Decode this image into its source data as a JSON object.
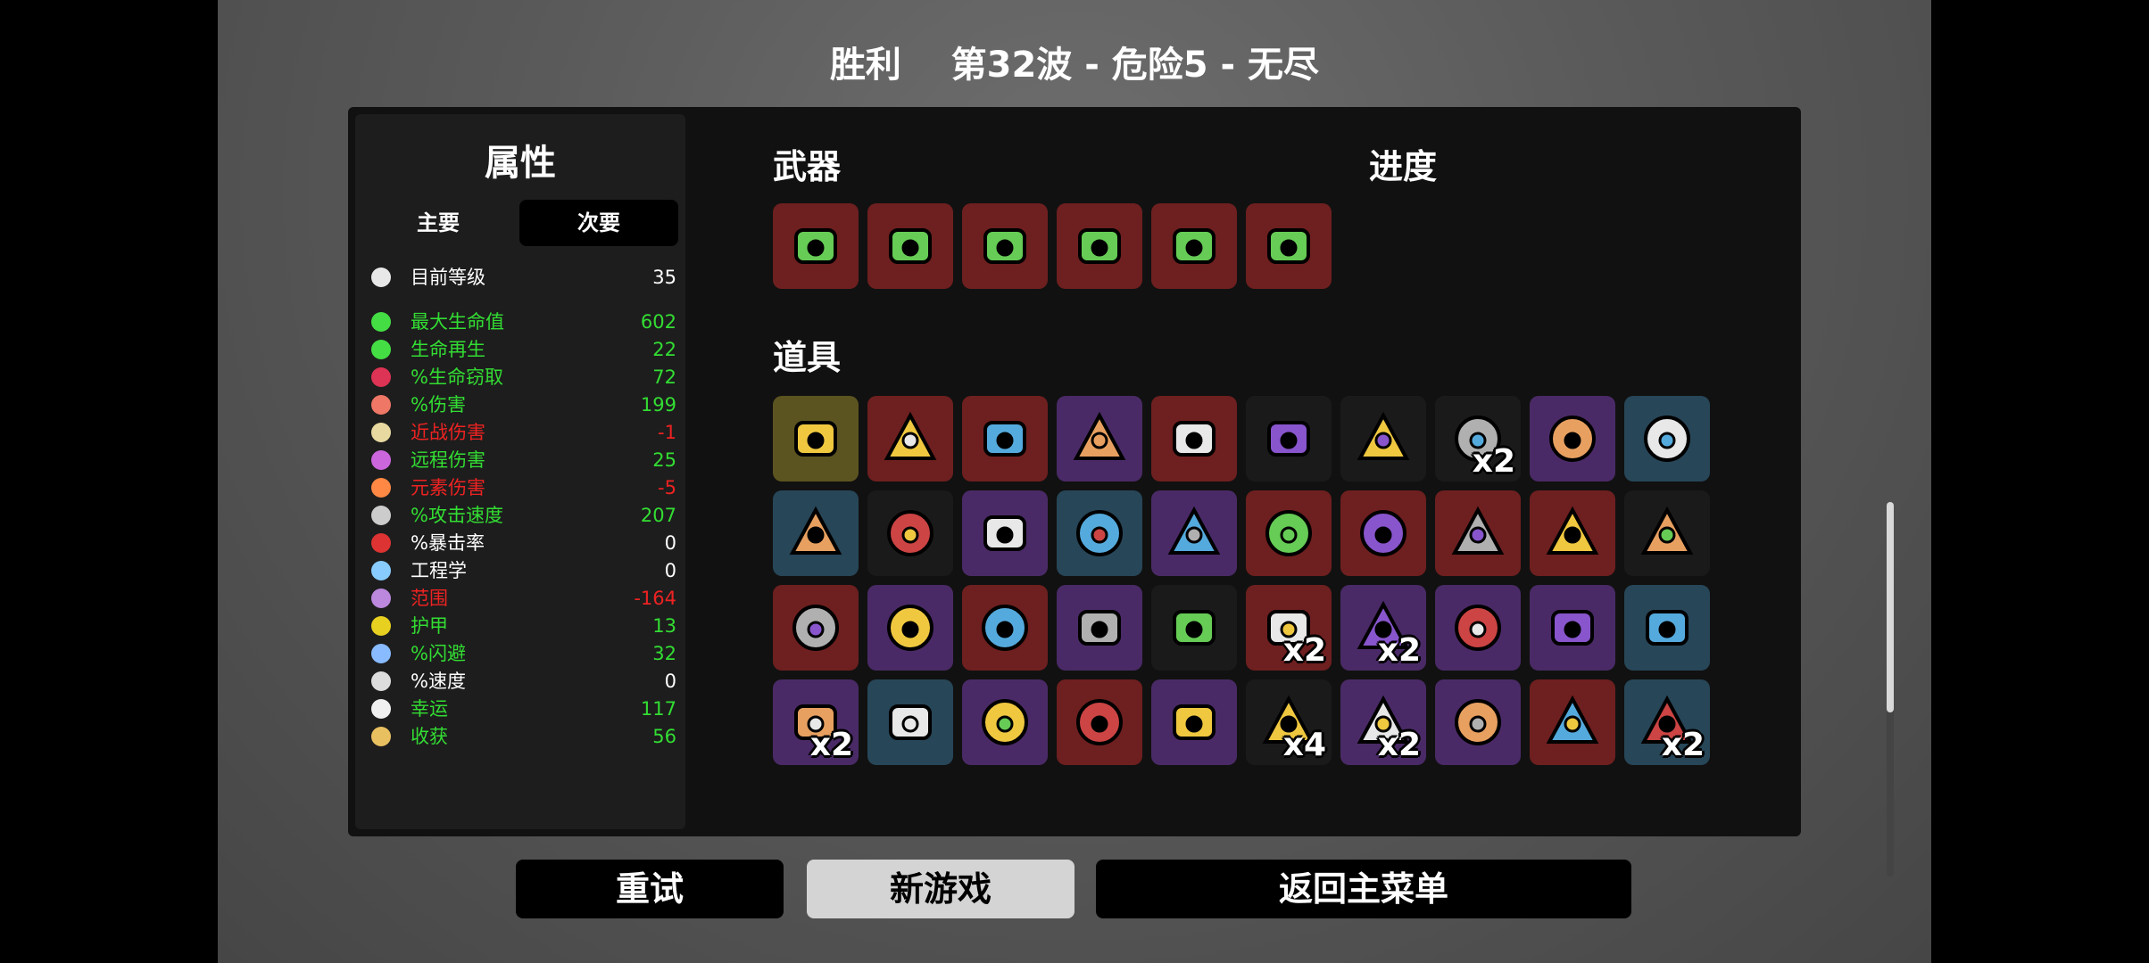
{
  "header": {
    "result": "胜利",
    "wave_info": "第32波 - 危险5 - 无尽"
  },
  "stats": {
    "title": "属性",
    "tabs": [
      "主要",
      "次要"
    ],
    "active_tab": "次要",
    "level": {
      "label": "目前等级",
      "value": "35",
      "icon": "level-icon"
    },
    "rows": [
      {
        "label": "最大生命值",
        "value": "602",
        "color": "#33dd33",
        "icon": "heart-icon"
      },
      {
        "label": "生命再生",
        "value": "22",
        "color": "#33dd33",
        "icon": "regen-heart-icon"
      },
      {
        "label": "%生命窃取",
        "value": "72",
        "color": "#33dd33",
        "icon": "fangs-icon"
      },
      {
        "label": "%伤害",
        "value": "199",
        "color": "#33dd33",
        "icon": "muscle-icon"
      },
      {
        "label": "近战伤害",
        "value": "-1",
        "color": "#ee2222",
        "icon": "sword-icon"
      },
      {
        "label": "远程伤害",
        "value": "25",
        "color": "#33dd33",
        "icon": "bow-icon"
      },
      {
        "label": "元素伤害",
        "value": "-5",
        "color": "#ee2222",
        "icon": "flame-icon"
      },
      {
        "label": "%攻击速度",
        "value": "207",
        "color": "#33dd33",
        "icon": "hourglass-icon"
      },
      {
        "label": "%暴击率",
        "value": "0",
        "color": "#ffffff",
        "icon": "crit-icon"
      },
      {
        "label": "工程学",
        "value": "0",
        "color": "#ffffff",
        "icon": "wrench-icon"
      },
      {
        "label": "范围",
        "value": "-164",
        "color": "#ee2222",
        "icon": "range-icon"
      },
      {
        "label": "护甲",
        "value": "13",
        "color": "#33dd33",
        "icon": "shield-icon"
      },
      {
        "label": "%闪避",
        "value": "32",
        "color": "#33dd33",
        "icon": "dodge-icon"
      },
      {
        "label": "%速度",
        "value": "0",
        "color": "#ffffff",
        "icon": "boot-icon"
      },
      {
        "label": "幸运",
        "value": "117",
        "color": "#33dd33",
        "icon": "dice-icon"
      },
      {
        "label": "收获",
        "value": "56",
        "color": "#33dd33",
        "icon": "harvest-icon"
      }
    ]
  },
  "weapons": {
    "title": "武器",
    "items": [
      {
        "icon": "minigun-icon",
        "tier_color": "#6e1f1f"
      },
      {
        "icon": "minigun-icon",
        "tier_color": "#6e1f1f"
      },
      {
        "icon": "minigun-icon",
        "tier_color": "#6e1f1f"
      },
      {
        "icon": "minigun-icon",
        "tier_color": "#6e1f1f"
      },
      {
        "icon": "minigun-icon",
        "tier_color": "#6e1f1f"
      },
      {
        "icon": "minigun-icon",
        "tier_color": "#6e1f1f"
      }
    ]
  },
  "progress": {
    "title": "进度"
  },
  "items": {
    "title": "道具",
    "list": [
      {
        "icon": "egg-face-icon",
        "tier_color": "#5c5420",
        "qty": ""
      },
      {
        "icon": "torn-hand-icon",
        "tier_color": "#6e1f1f",
        "qty": ""
      },
      {
        "icon": "bullet-icon",
        "tier_color": "#6e1f1f",
        "qty": ""
      },
      {
        "icon": "ring-icon",
        "tier_color": "#4a2a66",
        "qty": ""
      },
      {
        "icon": "jacket-icon",
        "tier_color": "#6e1f1f",
        "qty": ""
      },
      {
        "icon": "jar-icon",
        "tier_color": "#1a1a1a",
        "qty": ""
      },
      {
        "icon": "helmet-icon",
        "tier_color": "#1a1a1a",
        "qty": ""
      },
      {
        "icon": "claw-icon",
        "tier_color": "#1a1a1a",
        "qty": "x2"
      },
      {
        "icon": "wand-icon",
        "tier_color": "#4a2a66",
        "qty": ""
      },
      {
        "icon": "spike-icon",
        "tier_color": "#274658",
        "qty": ""
      },
      {
        "icon": "rifle-icon",
        "tier_color": "#274658",
        "qty": ""
      },
      {
        "icon": "map-icon",
        "tier_color": "#1a1a1a",
        "qty": ""
      },
      {
        "icon": "skulls-icon",
        "tier_color": "#4a2a66",
        "qty": ""
      },
      {
        "icon": "tentacle-icon",
        "tier_color": "#274658",
        "qty": ""
      },
      {
        "icon": "bucket-icon",
        "tier_color": "#4a2a66",
        "qty": ""
      },
      {
        "icon": "spear-icon",
        "tier_color": "#6e1f1f",
        "qty": ""
      },
      {
        "icon": "cape-icon",
        "tier_color": "#6e1f1f",
        "qty": ""
      },
      {
        "icon": "potato-icon",
        "tier_color": "#6e1f1f",
        "qty": ""
      },
      {
        "icon": "explosion-icon",
        "tier_color": "#6e1f1f",
        "qty": ""
      },
      {
        "icon": "cake-icon",
        "tier_color": "#1a1a1a",
        "qty": ""
      },
      {
        "icon": "stomach-icon",
        "tier_color": "#6e1f1f",
        "qty": ""
      },
      {
        "icon": "tardigrade-icon",
        "tier_color": "#4a2a66",
        "qty": ""
      },
      {
        "icon": "snowflake-icon",
        "tier_color": "#6e1f1f",
        "qty": ""
      },
      {
        "icon": "crown-icon",
        "tier_color": "#4a2a66",
        "qty": ""
      },
      {
        "icon": "bird-skull-icon",
        "tier_color": "#1a1a1a",
        "qty": ""
      },
      {
        "icon": "leaf-icon",
        "tier_color": "#6e1f1f",
        "qty": "x2"
      },
      {
        "icon": "flask-icon",
        "tier_color": "#4a2a66",
        "qty": "x2"
      },
      {
        "icon": "statue-icon",
        "tier_color": "#4a2a66",
        "qty": ""
      },
      {
        "icon": "demon-icon",
        "tier_color": "#4a2a66",
        "qty": ""
      },
      {
        "icon": "robot-icon",
        "tier_color": "#274658",
        "qty": ""
      },
      {
        "icon": "peacock-icon",
        "tier_color": "#4a2a66",
        "qty": "x2"
      },
      {
        "icon": "flashlight-icon",
        "tier_color": "#274658",
        "qty": ""
      },
      {
        "icon": "bowler-hat-icon",
        "tier_color": "#4a2a66",
        "qty": ""
      },
      {
        "icon": "anvil-icon",
        "tier_color": "#6e1f1f",
        "qty": ""
      },
      {
        "icon": "knight-helmet-icon",
        "tier_color": "#4a2a66",
        "qty": ""
      },
      {
        "icon": "propeller-hat-icon",
        "tier_color": "#1a1a1a",
        "qty": "x4"
      },
      {
        "icon": "gremlin-icon",
        "tier_color": "#4a2a66",
        "qty": "x2"
      },
      {
        "icon": "mustache-icon",
        "tier_color": "#4a2a66",
        "qty": ""
      },
      {
        "icon": "panda-icon",
        "tier_color": "#6e1f1f",
        "qty": ""
      },
      {
        "icon": "rocket-icon",
        "tier_color": "#274658",
        "qty": "x2"
      }
    ]
  },
  "buttons": {
    "retry": "重试",
    "new_game": "新游戏",
    "main_menu": "返回主菜单"
  }
}
